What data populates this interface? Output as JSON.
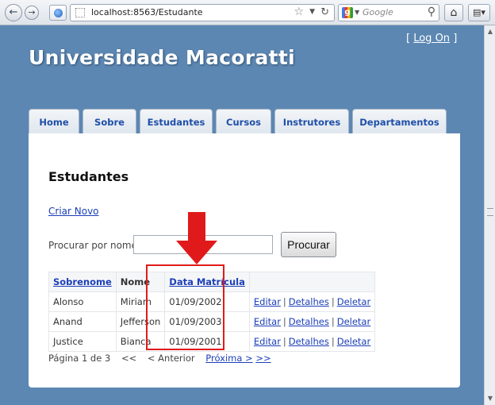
{
  "browser": {
    "url": "localhost:8563/Estudante",
    "search_placeholder": "Google"
  },
  "header": {
    "logon_open": "[",
    "logon_label": "Log On",
    "logon_close": "]",
    "title": "Universidade Macoratti"
  },
  "nav": {
    "tabs": [
      {
        "label": "Home"
      },
      {
        "label": "Sobre"
      },
      {
        "label": "Estudantes"
      },
      {
        "label": "Cursos"
      },
      {
        "label": "Instrutores"
      },
      {
        "label": "Departamentos"
      }
    ]
  },
  "main": {
    "heading": "Estudantes",
    "create_link": "Criar Novo",
    "search_label": "Procurar por nome:",
    "search_value": "",
    "search_button": "Procurar",
    "table": {
      "headers": [
        "Sobrenome",
        "Nome",
        "Data Matrícula"
      ],
      "rows": [
        {
          "last": "Alonso",
          "first": "Miriam",
          "date": "01/09/2002"
        },
        {
          "last": "Anand",
          "first": "Jefferson",
          "date": "01/09/2003"
        },
        {
          "last": "Justice",
          "first": "Bianca",
          "date": "01/09/2001"
        }
      ],
      "actions": {
        "edit": "Editar",
        "details": "Detalhes",
        "delete": "Deletar",
        "separator": "|"
      }
    },
    "pager": {
      "status": "Página 1 de 3",
      "first": "<<",
      "prev": "< Anterior",
      "next": "Próxima >",
      "last": ">>"
    }
  },
  "annotation": {
    "color": "#e01a1a"
  },
  "colors": {
    "page_bg": "#5c87b2",
    "link": "#1c3fb8",
    "tab_text": "#1f4fa8"
  }
}
